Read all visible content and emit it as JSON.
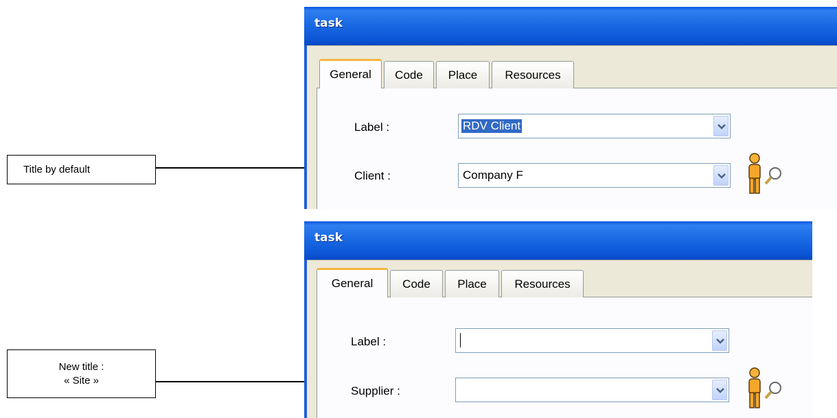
{
  "callouts": {
    "first": "Title by default",
    "second_line1": "New title :",
    "second_line2": "« Site »"
  },
  "windows": [
    {
      "title": "task",
      "tabs": [
        "General",
        "Code",
        "Place",
        "Resources"
      ],
      "active_tab": "General",
      "label_field": {
        "label": "Label :",
        "value": "RDV Client",
        "selected": true
      },
      "second_field": {
        "label": "Client :",
        "value": "Company F"
      },
      "icon": "person-search-icon"
    },
    {
      "title": "task",
      "tabs": [
        "General",
        "Code",
        "Place",
        "Resources"
      ],
      "active_tab": "General",
      "label_field": {
        "label": "Label :",
        "value": ""
      },
      "second_field": {
        "label": "Supplier :",
        "value": ""
      },
      "icon": "person-search-icon"
    }
  ],
  "colors": {
    "titlebar": "#0b55d6",
    "selection": "#316ac5",
    "tab_accent": "#f7b540"
  }
}
